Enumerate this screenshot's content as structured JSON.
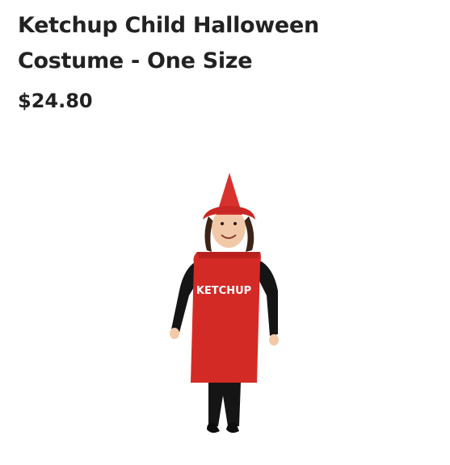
{
  "product": {
    "title": "Ketchup Child Halloween Costume - One Size",
    "price": "$24.80",
    "image": {
      "costume_print": "KETCHUP",
      "costume_color": "#d42a26",
      "hat_color": "#d8322e",
      "clothing_color": "#151515"
    }
  }
}
